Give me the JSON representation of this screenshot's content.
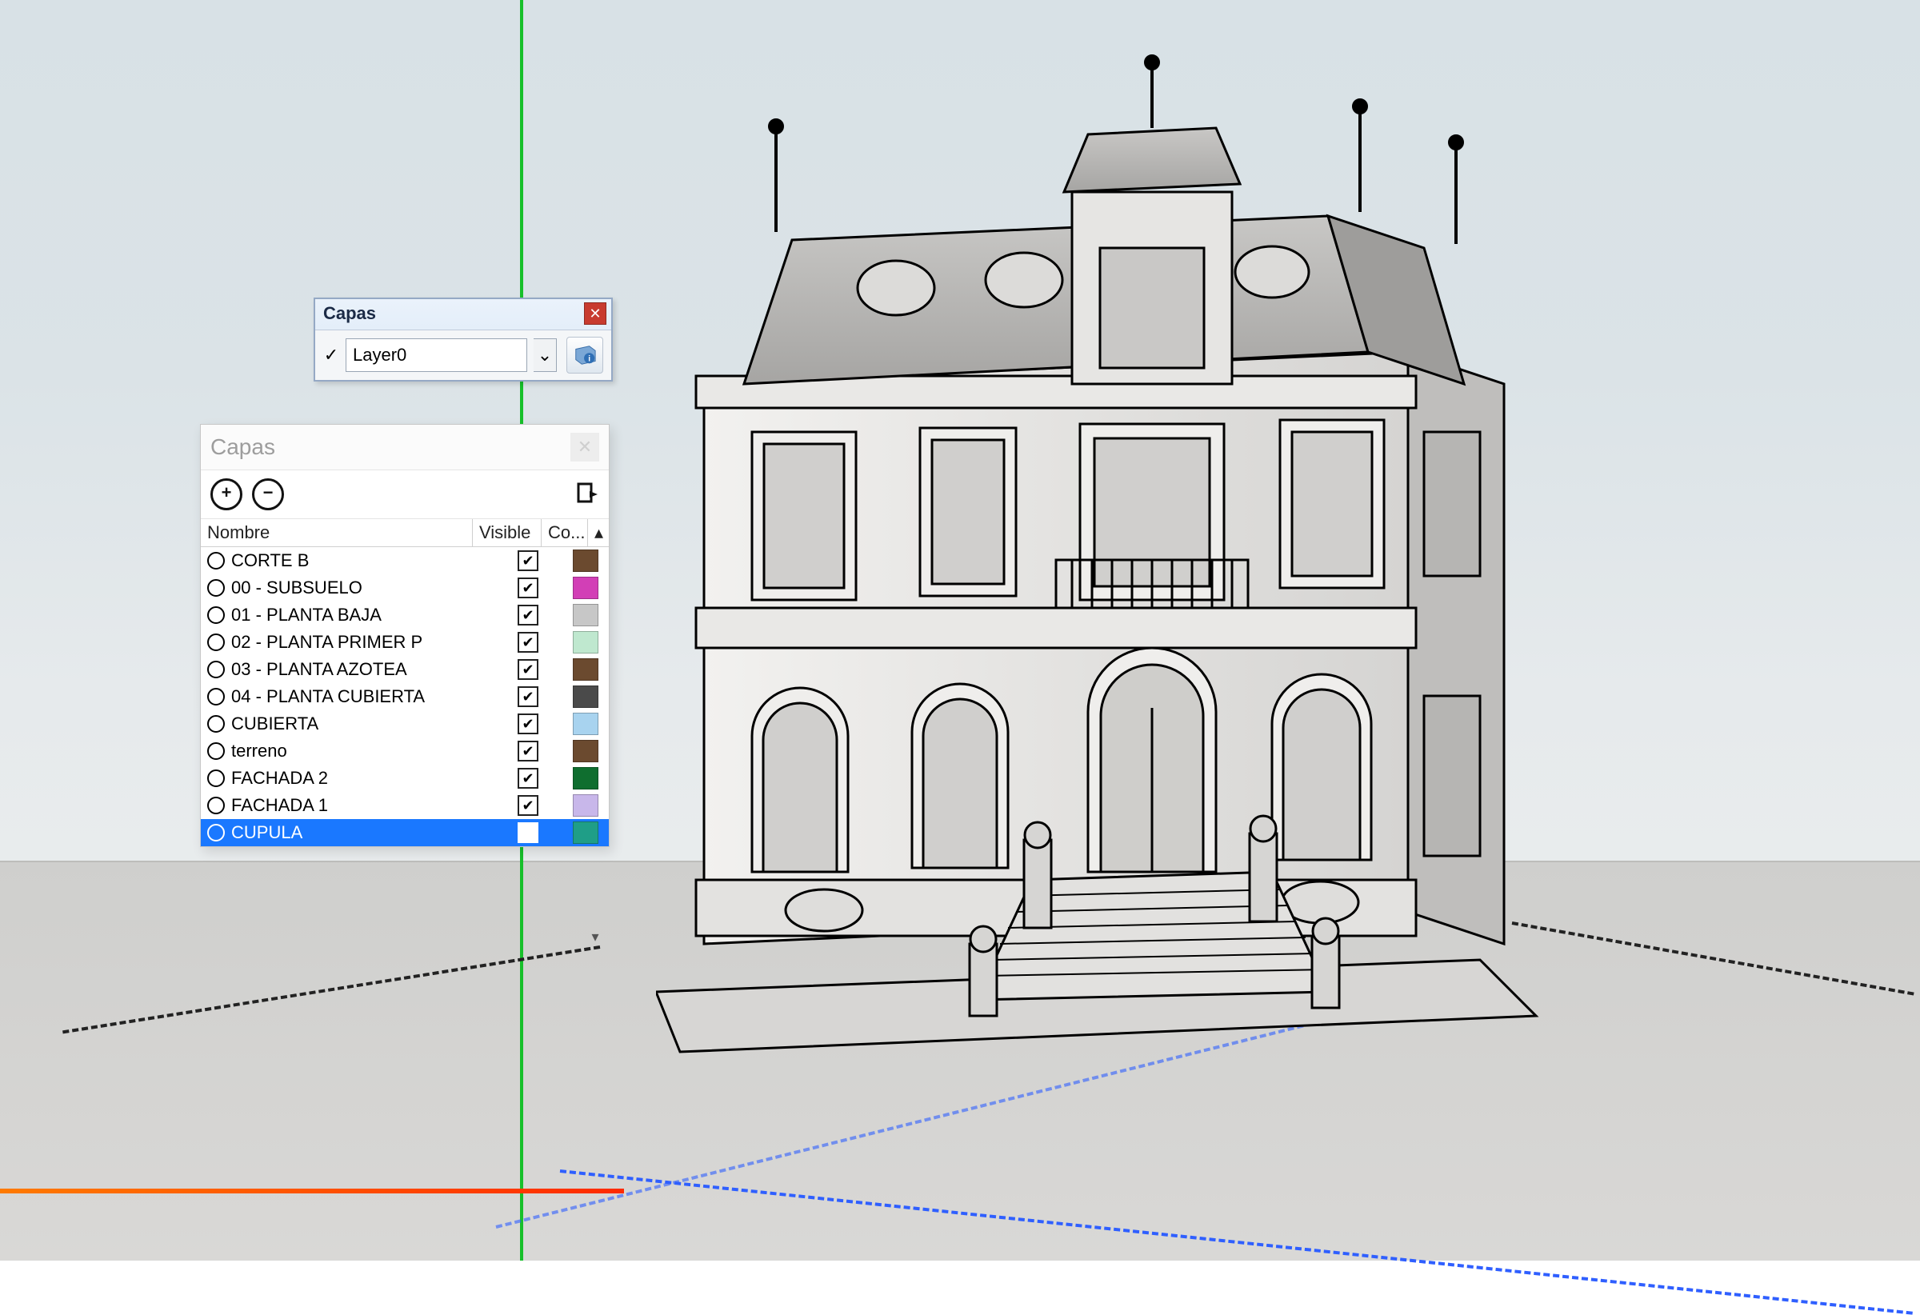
{
  "toolbar": {
    "title": "Capas",
    "active_check": "✓",
    "selected_layer": "Layer0",
    "dropdown_glyph": "⌄",
    "close_glyph": "✕"
  },
  "panel": {
    "title": "Capas",
    "close_glyph": "✕",
    "add_glyph": "+",
    "remove_glyph": "−",
    "details_glyph": "▸",
    "columns": {
      "name": "Nombre",
      "visible": "Visible",
      "color": "Co...",
      "scroll_up": "▴"
    },
    "scroll_down": "▾",
    "layers": [
      {
        "name": "CORTE B",
        "visible": true,
        "color": "#6b4a2f",
        "selected": false
      },
      {
        "name": "00 - SUBSUELO",
        "visible": true,
        "color": "#d23fb6",
        "selected": false
      },
      {
        "name": "01 - PLANTA BAJA",
        "visible": true,
        "color": "#c7c7c7",
        "selected": false
      },
      {
        "name": "02 - PLANTA PRIMER P",
        "visible": true,
        "color": "#bfe8cf",
        "selected": false
      },
      {
        "name": "03 - PLANTA AZOTEA",
        "visible": true,
        "color": "#6b4a2f",
        "selected": false
      },
      {
        "name": "04 - PLANTA CUBIERTA",
        "visible": true,
        "color": "#4a4a4a",
        "selected": false
      },
      {
        "name": "CUBIERTA",
        "visible": true,
        "color": "#a8d3ef",
        "selected": false
      },
      {
        "name": "terreno",
        "visible": true,
        "color": "#6b4a2f",
        "selected": false
      },
      {
        "name": "FACHADA 2",
        "visible": true,
        "color": "#0f6e2f",
        "selected": false
      },
      {
        "name": "FACHADA 1",
        "visible": true,
        "color": "#c8b7ea",
        "selected": false
      },
      {
        "name": "CUPULA",
        "visible": false,
        "color": "#1f9e87",
        "selected": true
      }
    ]
  },
  "axes": {
    "green": "#17c02a",
    "red": "#ff4a00",
    "blue": "#2f5fff"
  },
  "model_label": "Classical building 3D model (wireframe render)"
}
